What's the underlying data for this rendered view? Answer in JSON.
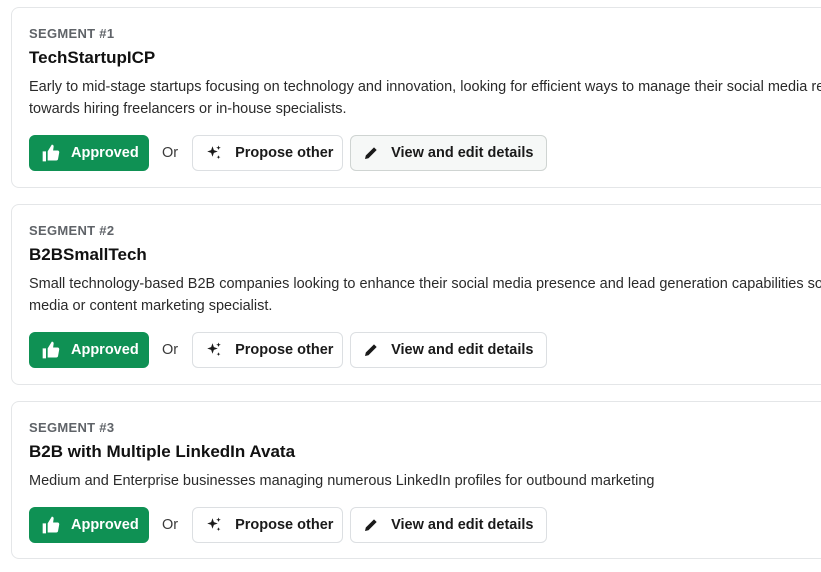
{
  "segments": [
    {
      "label": "SEGMENT #1",
      "title": "TechStartupICP",
      "description": "Early to mid-stage startups focusing on technology and innovation, looking for efficient ways to manage their social media resources towards hiring freelancers or in-house specialists.",
      "approved_label": "Approved",
      "or_label": "Or",
      "propose_label": "Propose other",
      "view_label": "View and edit details"
    },
    {
      "label": "SEGMENT #2",
      "title": "B2BSmallTech",
      "description": "Small technology-based B2B companies looking to enhance their social media presence and lead generation capabilities social media or content marketing specialist.",
      "approved_label": "Approved",
      "or_label": "Or",
      "propose_label": "Propose other",
      "view_label": "View and edit details"
    },
    {
      "label": "SEGMENT #3",
      "title": "B2B with Multiple LinkedIn Avata",
      "description": "Medium and Enterprise businesses managing numerous LinkedIn profiles for outbound marketing",
      "approved_label": "Approved",
      "or_label": "Or",
      "propose_label": "Propose other",
      "view_label": "View and edit details"
    }
  ],
  "colors": {
    "approved_bg": "#0f9154",
    "card_border": "#e4e6e8",
    "label_gray": "#5f6368"
  },
  "icons": {
    "approved": "thumbs-up-icon",
    "propose": "sparkles-icon",
    "view": "pencil-icon"
  }
}
